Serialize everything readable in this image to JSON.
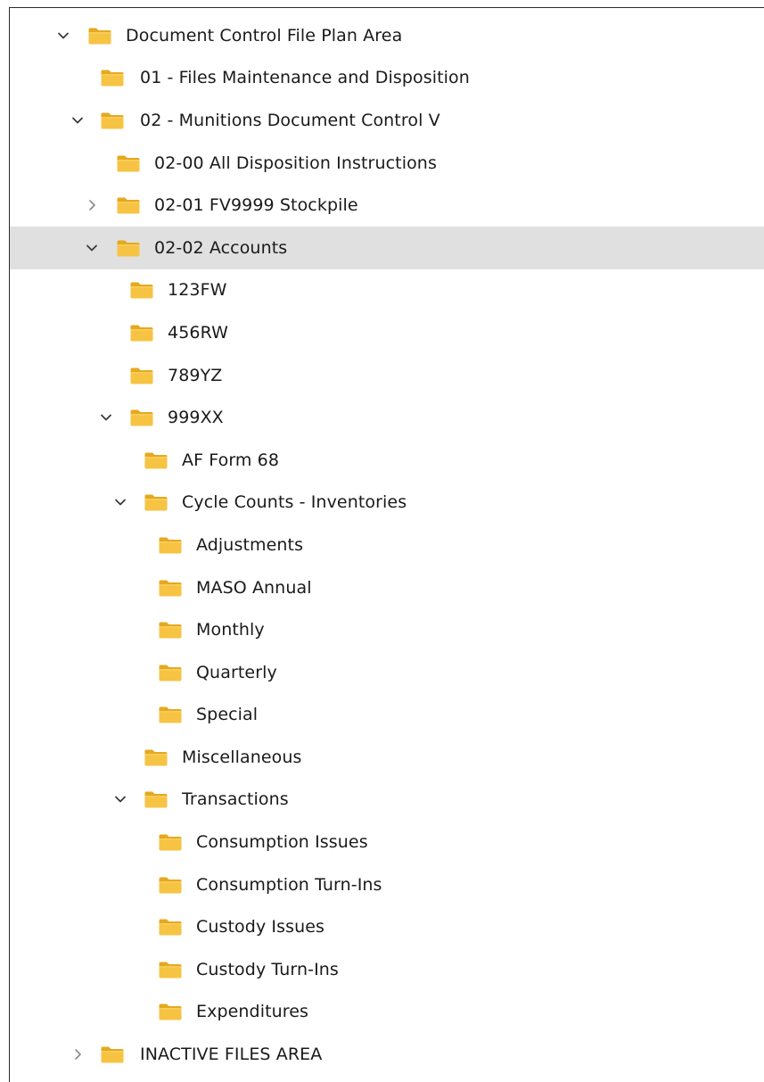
{
  "colors": {
    "folder_front": "#f6c343",
    "folder_back": "#e5a91f",
    "selection": "#e0e0e0",
    "chevron": "#3a3a3a"
  },
  "tree": {
    "items": [
      {
        "label": "Document Control File Plan Area",
        "level": 0,
        "state": "expanded",
        "icon": "folder-icon"
      },
      {
        "label": "01 - Files Maintenance and Disposition",
        "level": 1,
        "state": "leaf",
        "icon": "folder-icon"
      },
      {
        "label": "02 - Munitions Document Control V",
        "level": 1,
        "state": "expanded",
        "icon": "folder-icon"
      },
      {
        "label": "02-00 All Disposition Instructions",
        "level": 2,
        "state": "leaf",
        "icon": "folder-icon"
      },
      {
        "label": "02-01 FV9999 Stockpile",
        "level": 2,
        "state": "collapsed",
        "icon": "folder-icon"
      },
      {
        "label": "02-02 Accounts",
        "level": 2,
        "state": "expanded",
        "icon": "folder-icon",
        "selected": true
      },
      {
        "label": "123FW",
        "level": 3,
        "state": "leaf",
        "icon": "folder-icon"
      },
      {
        "label": "456RW",
        "level": 3,
        "state": "leaf",
        "icon": "folder-icon"
      },
      {
        "label": "789YZ",
        "level": 3,
        "state": "leaf",
        "icon": "folder-icon"
      },
      {
        "label": "999XX",
        "level": 3,
        "state": "expanded",
        "icon": "folder-icon"
      },
      {
        "label": "AF Form 68",
        "level": 4,
        "state": "leaf",
        "icon": "folder-icon"
      },
      {
        "label": "Cycle Counts - Inventories",
        "level": 4,
        "state": "expanded",
        "icon": "folder-icon"
      },
      {
        "label": "Adjustments",
        "level": 5,
        "state": "leaf",
        "icon": "folder-icon"
      },
      {
        "label": "MASO Annual",
        "level": 5,
        "state": "leaf",
        "icon": "folder-icon"
      },
      {
        "label": "Monthly",
        "level": 5,
        "state": "leaf",
        "icon": "folder-icon"
      },
      {
        "label": "Quarterly",
        "level": 5,
        "state": "leaf",
        "icon": "folder-icon"
      },
      {
        "label": "Special",
        "level": 5,
        "state": "leaf",
        "icon": "folder-icon"
      },
      {
        "label": "Miscellaneous",
        "level": 4,
        "state": "leaf",
        "icon": "folder-icon"
      },
      {
        "label": "Transactions",
        "level": 4,
        "state": "expanded",
        "icon": "folder-icon"
      },
      {
        "label": "Consumption Issues",
        "level": 5,
        "state": "leaf",
        "icon": "folder-icon"
      },
      {
        "label": "Consumption Turn-Ins",
        "level": 5,
        "state": "leaf",
        "icon": "folder-icon"
      },
      {
        "label": "Custody Issues",
        "level": 5,
        "state": "leaf",
        "icon": "folder-icon"
      },
      {
        "label": "Custody Turn-Ins",
        "level": 5,
        "state": "leaf",
        "icon": "folder-icon"
      },
      {
        "label": "Expenditures",
        "level": 5,
        "state": "leaf",
        "icon": "folder-icon"
      },
      {
        "label": "INACTIVE FILES AREA",
        "level": 1,
        "state": "collapsed",
        "icon": "folder-icon"
      }
    ]
  }
}
